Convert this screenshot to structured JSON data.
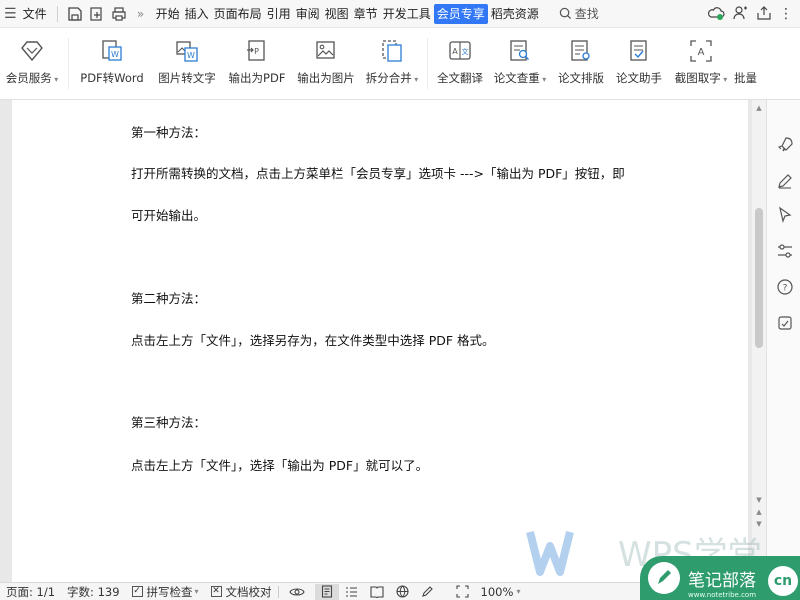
{
  "menubar": {
    "file": "文件",
    "tabs": [
      {
        "label": "开始",
        "active": false
      },
      {
        "label": "插入",
        "active": false
      },
      {
        "label": "页面布局",
        "active": false
      },
      {
        "label": "引用",
        "active": false
      },
      {
        "label": "审阅",
        "active": false
      },
      {
        "label": "视图",
        "active": false
      },
      {
        "label": "章节",
        "active": false
      },
      {
        "label": "开发工具",
        "active": false
      },
      {
        "label": "会员专享",
        "active": true
      },
      {
        "label": "稻壳资源",
        "active": false
      }
    ],
    "search": "查找"
  },
  "ribbon": {
    "buttons": [
      {
        "label": "会员服务",
        "icon": "diamond-icon",
        "dropdown": true
      },
      {
        "label": "PDF转Word",
        "icon": "pdf-to-word-icon",
        "dropdown": false
      },
      {
        "label": "图片转文字",
        "icon": "image-to-text-icon",
        "dropdown": false
      },
      {
        "label": "输出为PDF",
        "icon": "export-pdf-icon",
        "dropdown": false
      },
      {
        "label": "输出为图片",
        "icon": "export-image-icon",
        "dropdown": false
      },
      {
        "label": "拆分合并",
        "icon": "split-merge-icon",
        "dropdown": true
      },
      {
        "label": "全文翻译",
        "icon": "translate-icon",
        "dropdown": false
      },
      {
        "label": "论文查重",
        "icon": "plagiarism-check-icon",
        "dropdown": true
      },
      {
        "label": "论文排版",
        "icon": "thesis-format-icon",
        "dropdown": false
      },
      {
        "label": "论文助手",
        "icon": "thesis-assistant-icon",
        "dropdown": false
      },
      {
        "label": "截图取字",
        "icon": "screenshot-text-icon",
        "dropdown": true
      },
      {
        "label": "批量",
        "icon": "batch-icon",
        "dropdown": false
      }
    ]
  },
  "document": {
    "paragraphs": [
      "第一种方法：",
      "打开所需转换的文档，点击上方菜单栏「会员专享」选项卡 --->「输出为 PDF」按钮，即",
      "可开始输出。",
      "第二种方法：",
      "点击左上方「文件」，选择另存为，在文件类型中选择 PDF 格式。",
      "第三种方法：",
      "点击左上方「文件」，选择「输出为 PDF」就可以了。"
    ]
  },
  "statusbar": {
    "page": "页面: 1/1",
    "words": "字数: 139",
    "spellcheck": "拼写检查",
    "proofread": "文档校对",
    "zoom": "100%"
  },
  "watermark": {
    "wps": "WPS学堂",
    "badge": "笔记部落",
    "badge_sub": "www.notetribe.com",
    "badge_cn": "cn"
  }
}
